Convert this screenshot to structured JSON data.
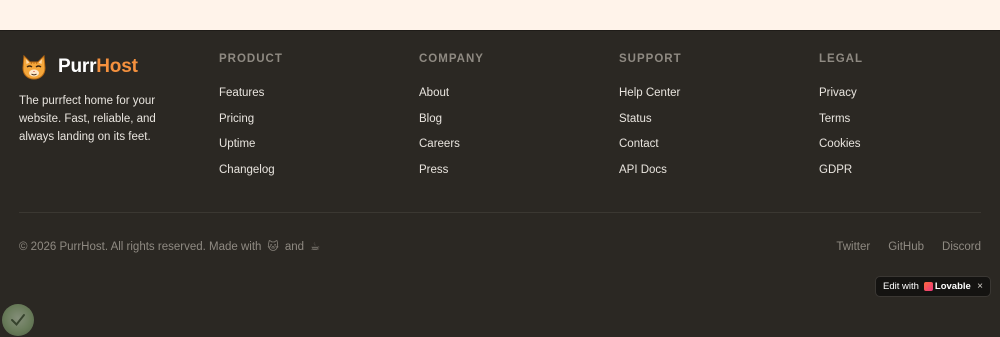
{
  "brand": {
    "name_part1": "Purr",
    "name_part2": "Host",
    "accent_color": "#f5913e",
    "logo_icon": "cat-face-icon",
    "description": "The purrfect home for your website. Fast, reliable, and always landing on its feet."
  },
  "columns": [
    {
      "title": "PRODUCT",
      "links": [
        "Features",
        "Pricing",
        "Uptime",
        "Changelog"
      ]
    },
    {
      "title": "COMPANY",
      "links": [
        "About",
        "Blog",
        "Careers",
        "Press"
      ]
    },
    {
      "title": "SUPPORT",
      "links": [
        "Help Center",
        "Status",
        "Contact",
        "API Docs"
      ]
    },
    {
      "title": "LEGAL",
      "links": [
        "Privacy",
        "Terms",
        "Cookies",
        "GDPR"
      ]
    }
  ],
  "bottom": {
    "copyright_text": "© 2026 PurrHost. All rights reserved. Made with",
    "emoji_1": "🐱",
    "and_text": "and",
    "emoji_2": "☕",
    "social_links": [
      "Twitter",
      "GitHub",
      "Discord"
    ]
  },
  "edit_badge": {
    "prefix": "Edit with",
    "brand": "Lovable",
    "close": "×"
  },
  "colors": {
    "footer_bg": "#2b2823",
    "top_band_bg": "#fff3ea",
    "muted_text": "#8f8a82",
    "link_text": "#e8e4de"
  }
}
